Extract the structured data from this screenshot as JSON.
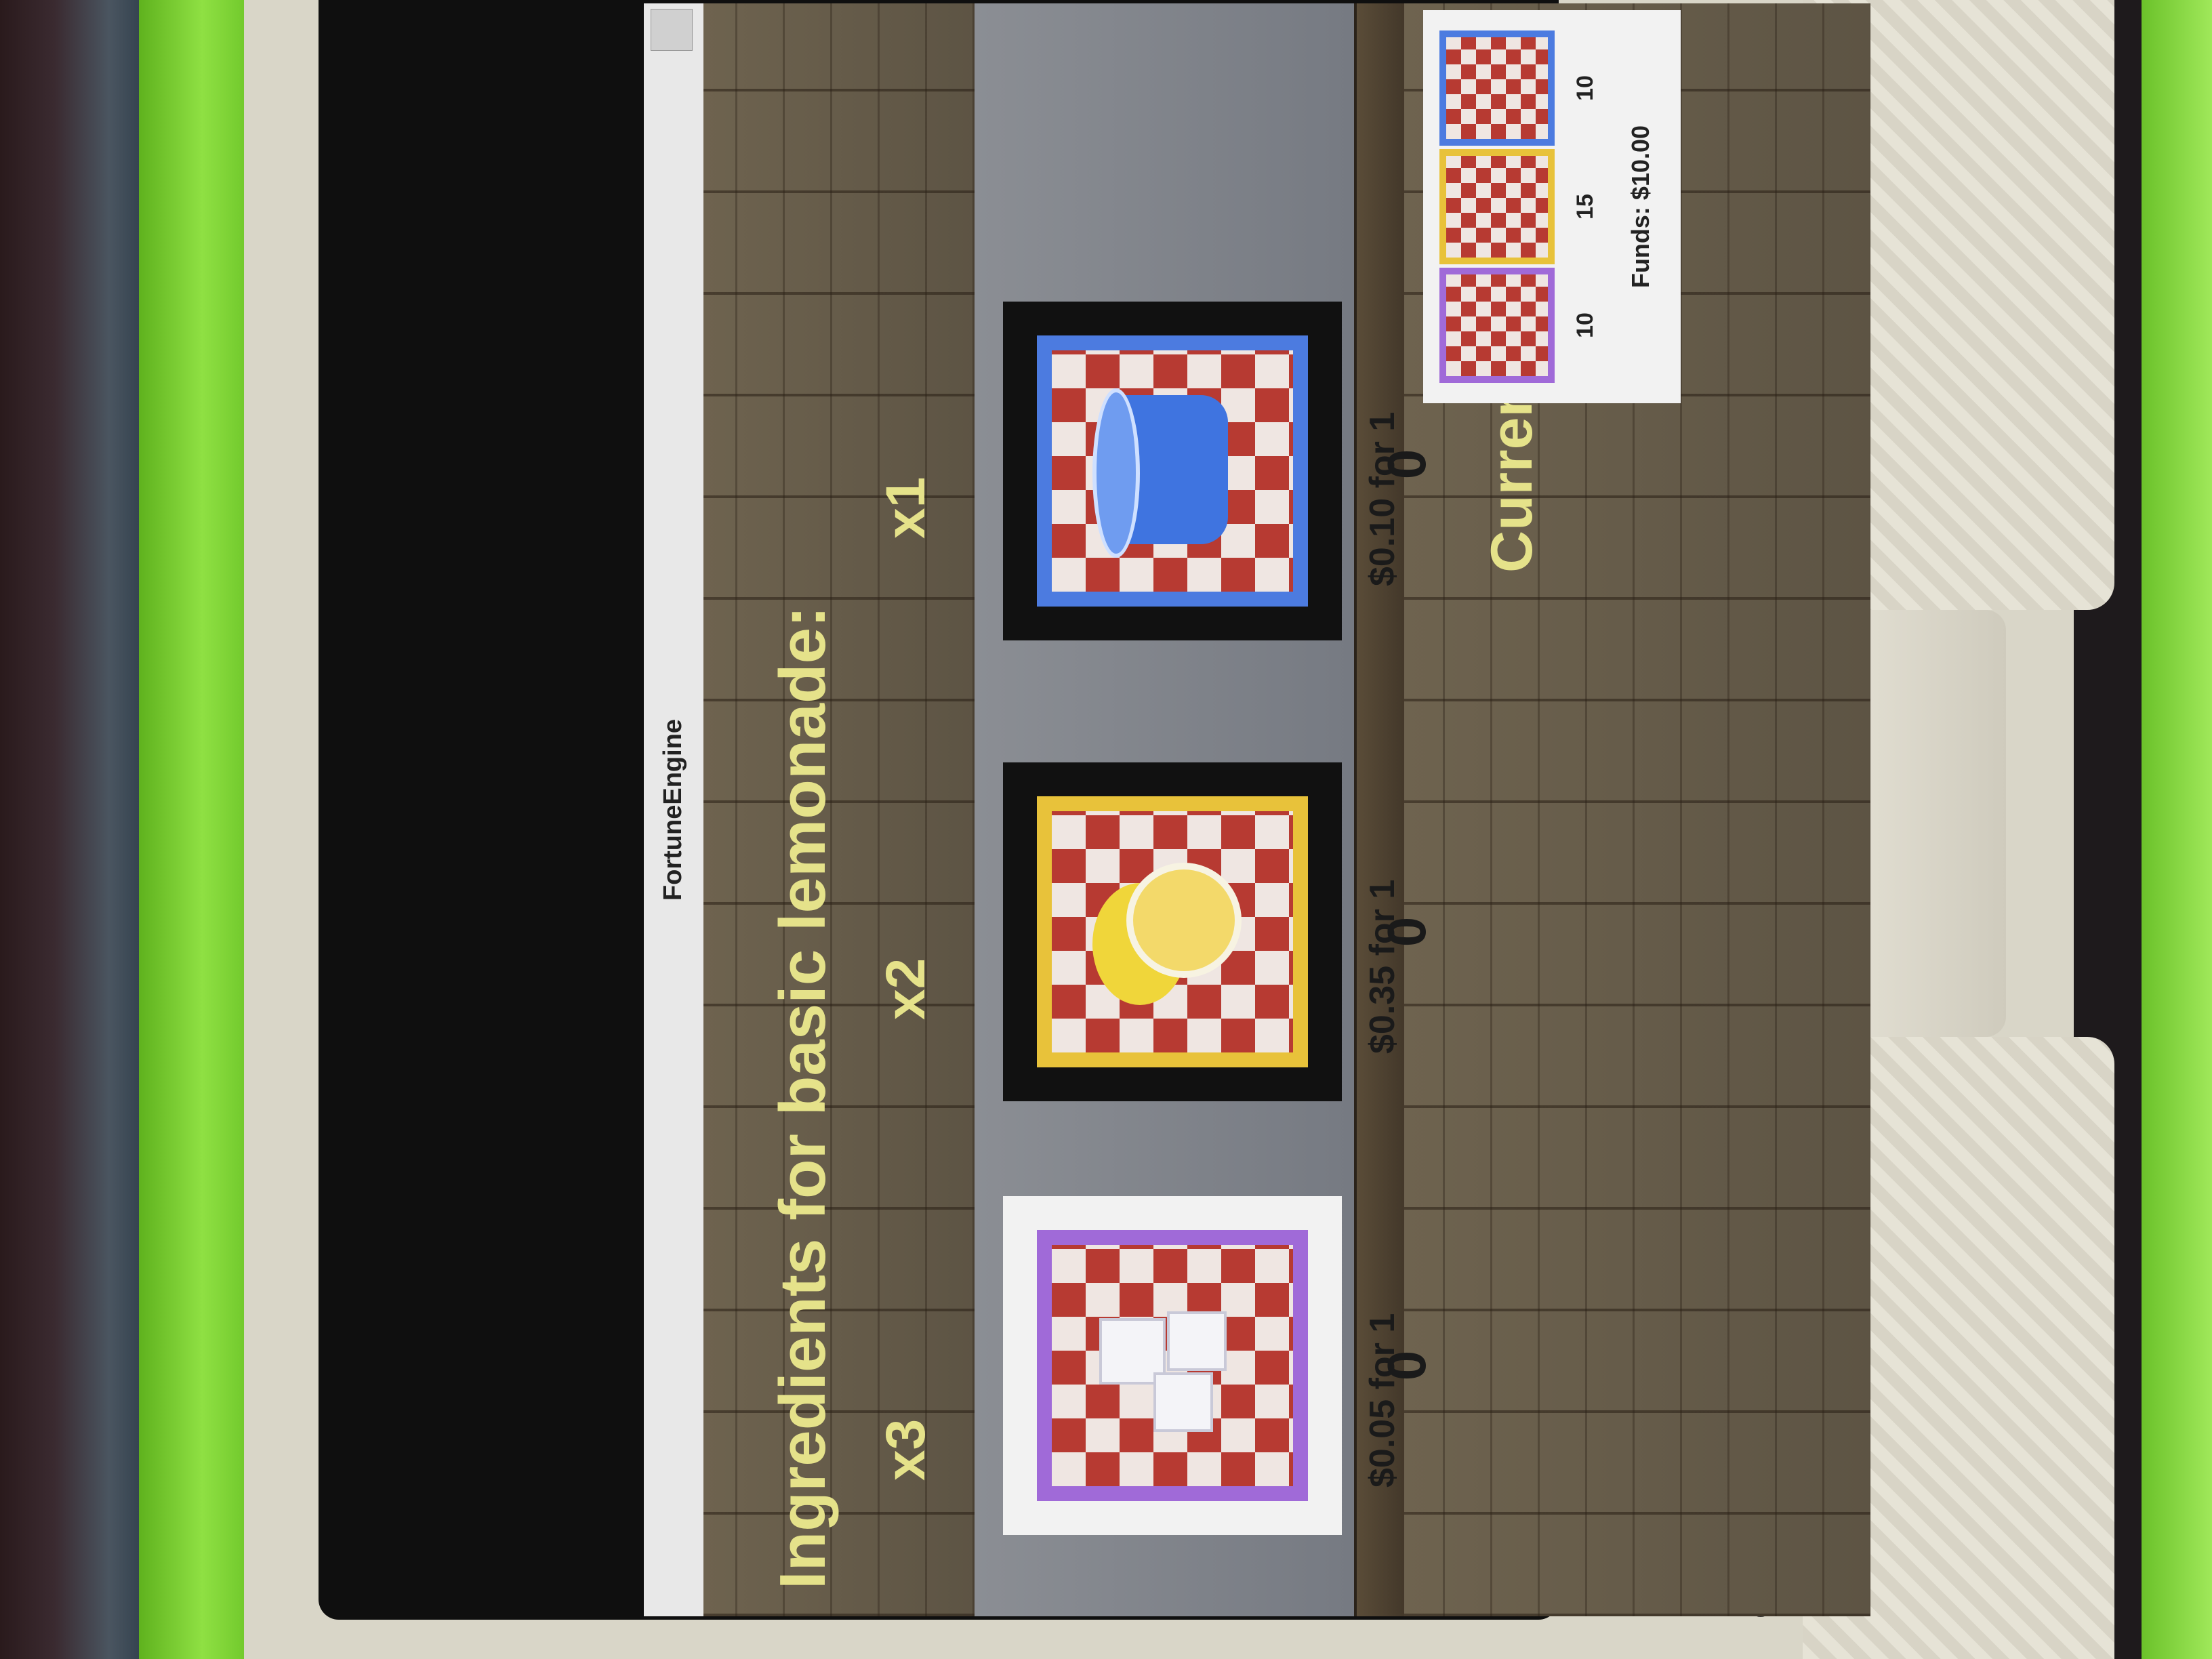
{
  "window": {
    "title": "FortuneEngine"
  },
  "store": {
    "heading": "Ingredients for basic lemonade:",
    "items": [
      {
        "name": "ice",
        "multiplier": "x3",
        "price": "$0.05 for 1",
        "quantity": "0",
        "icon": "ice-cubes-icon",
        "border_color": "#a06ad8"
      },
      {
        "name": "lemon",
        "multiplier": "x2",
        "price": "$0.35 for 1",
        "quantity": "0",
        "icon": "lemon-icon",
        "border_color": "#e8c23a"
      },
      {
        "name": "cup",
        "multiplier": "x1",
        "price": "$0.10 for 1",
        "quantity": "0",
        "icon": "cup-icon",
        "border_color": "#4c7be0"
      }
    ]
  },
  "supplies": {
    "label": "Current Supplies:",
    "items": [
      {
        "name": "ice",
        "count": "10",
        "icon": "ice-cubes-icon"
      },
      {
        "name": "lemon",
        "count": "15",
        "icon": "lemon-icon"
      },
      {
        "name": "cup",
        "count": "10",
        "icon": "cup-icon"
      }
    ],
    "funds": "Funds: $10.00"
  },
  "colors": {
    "heading_text": "#e5e28a",
    "device_green": "#8fe043"
  }
}
